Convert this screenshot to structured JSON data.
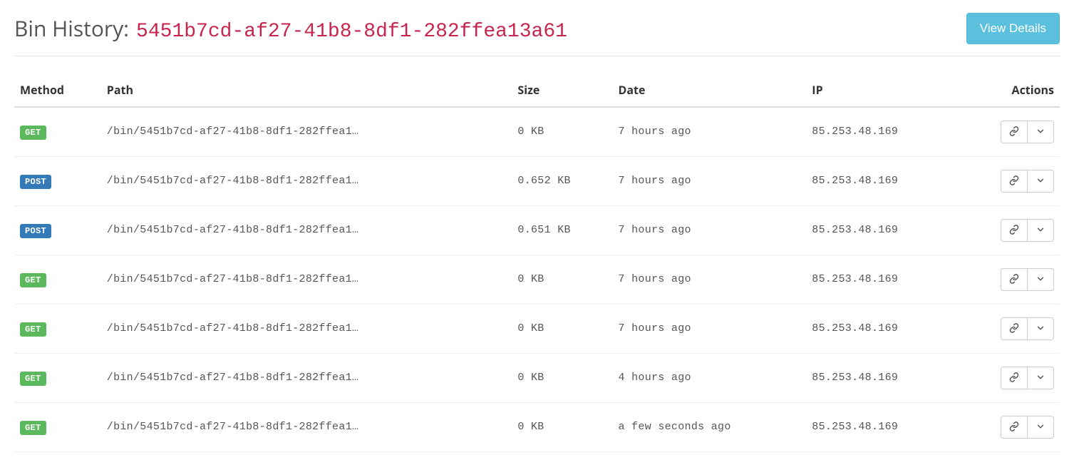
{
  "header": {
    "prefix": "Bin History:",
    "bin_id": "5451b7cd-af27-41b8-8df1-282ffea13a61",
    "view_details_label": "View Details"
  },
  "columns": {
    "method": "Method",
    "path": "Path",
    "size": "Size",
    "date": "Date",
    "ip": "IP",
    "actions": "Actions"
  },
  "rows": [
    {
      "method": "GET",
      "path": "/bin/5451b7cd-af27-41b8-8df1-282ffea1…",
      "size": "0 KB",
      "date": "7 hours ago",
      "ip": "85.253.48.169"
    },
    {
      "method": "POST",
      "path": "/bin/5451b7cd-af27-41b8-8df1-282ffea1…",
      "size": "0.652 KB",
      "date": "7 hours ago",
      "ip": "85.253.48.169"
    },
    {
      "method": "POST",
      "path": "/bin/5451b7cd-af27-41b8-8df1-282ffea1…",
      "size": "0.651 KB",
      "date": "7 hours ago",
      "ip": "85.253.48.169"
    },
    {
      "method": "GET",
      "path": "/bin/5451b7cd-af27-41b8-8df1-282ffea1…",
      "size": "0 KB",
      "date": "7 hours ago",
      "ip": "85.253.48.169"
    },
    {
      "method": "GET",
      "path": "/bin/5451b7cd-af27-41b8-8df1-282ffea1…",
      "size": "0 KB",
      "date": "7 hours ago",
      "ip": "85.253.48.169"
    },
    {
      "method": "GET",
      "path": "/bin/5451b7cd-af27-41b8-8df1-282ffea1…",
      "size": "0 KB",
      "date": "4 hours ago",
      "ip": "85.253.48.169"
    },
    {
      "method": "GET",
      "path": "/bin/5451b7cd-af27-41b8-8df1-282ffea1…",
      "size": "0 KB",
      "date": "a few seconds ago",
      "ip": "85.253.48.169"
    }
  ],
  "icons": {
    "link": "link-icon",
    "expand": "chevron-down-icon"
  }
}
